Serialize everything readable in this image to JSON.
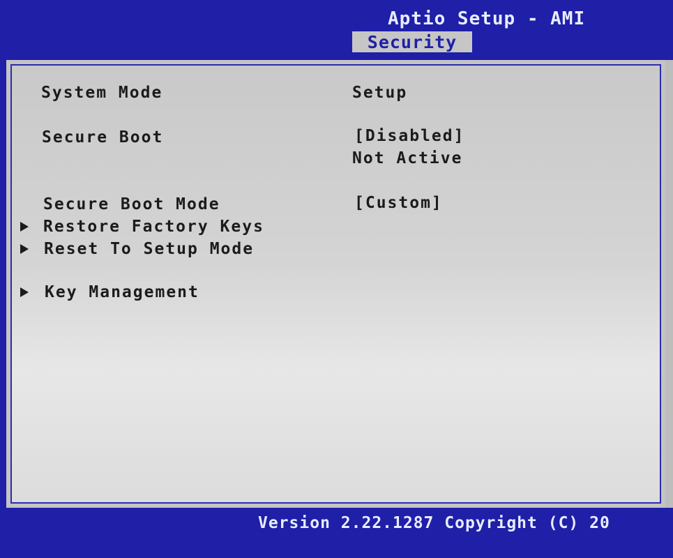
{
  "header": {
    "app_title": "Aptio Setup - AMI",
    "tabs": [
      {
        "label": "Security",
        "active": true
      }
    ]
  },
  "main": {
    "items": [
      {
        "label": "System Mode",
        "value": "Setup"
      },
      {
        "label": "Secure Boot",
        "value": "[Disabled]",
        "value2": "Not Active"
      },
      {
        "label": "Secure Boot Mode",
        "value": "[Custom]"
      },
      {
        "label": "Restore Factory Keys",
        "submenu": true
      },
      {
        "label": "Reset To Setup Mode",
        "submenu": true
      },
      {
        "label": "Key Management",
        "submenu": true
      }
    ]
  },
  "footer": {
    "version": "Version 2.22.1287 Copyright (C) 20"
  },
  "colors": {
    "background_blue": "#1f1fa8",
    "panel_gray": "#c6c6c6",
    "text_dark": "#1b1b1b",
    "text_light": "#e8ecff"
  }
}
